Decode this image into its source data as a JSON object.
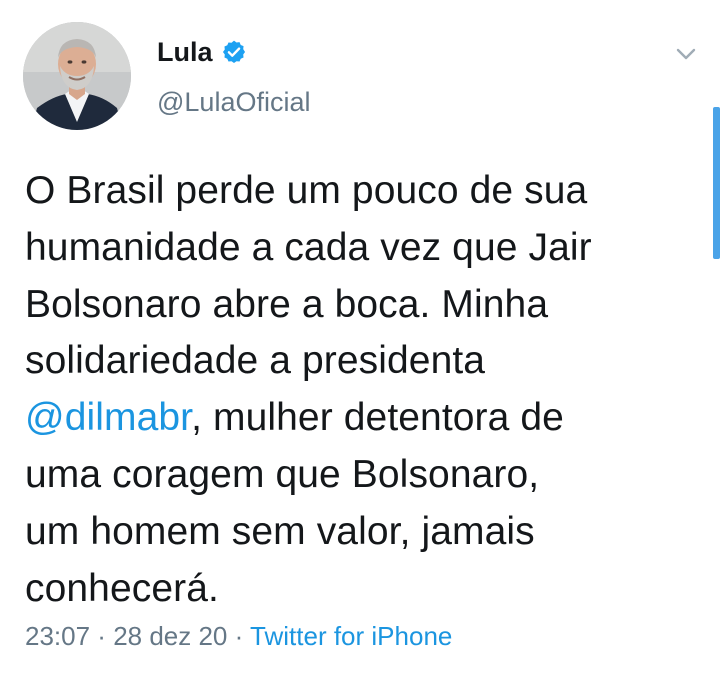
{
  "author": {
    "display_name": "Lula",
    "handle": "@LulaOficial",
    "verified": true
  },
  "icons": {
    "verified": "verified-badge-icon",
    "more": "chevron-down-icon"
  },
  "colors": {
    "text": "#14171a",
    "secondary": "#657786",
    "link": "#1b95e0",
    "verified_badge": "#1da1f2"
  },
  "tweet": {
    "lines": [
      {
        "text": "O Brasil perde um pouco de sua"
      },
      {
        "text": "humanidade a cada vez que Jair"
      },
      {
        "text": "Bolsonaro abre a boca. Minha"
      },
      {
        "text": "solidariedade a presidenta"
      },
      {
        "mention": "@dilmabr",
        "text": ", mulher detentora de"
      },
      {
        "text": "uma coragem que Bolsonaro,"
      },
      {
        "text": "um homem sem valor, jamais"
      },
      {
        "text": "conhecerá."
      }
    ]
  },
  "meta": {
    "time": "23:07",
    "separator": " · ",
    "date": "28 dez 20",
    "source": "Twitter for iPhone"
  }
}
